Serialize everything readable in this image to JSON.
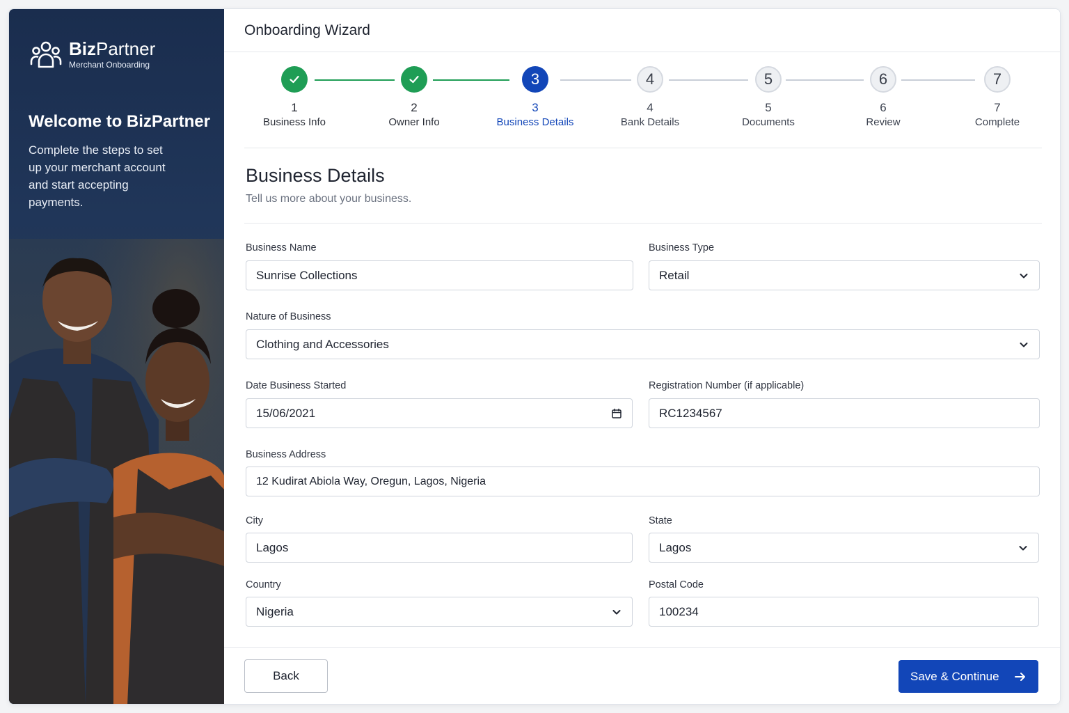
{
  "brand": {
    "name_bold": "Biz",
    "name_rest": "Partner",
    "subtitle": "Merchant Onboarding"
  },
  "sidebar": {
    "welcome_title": "Welcome to BizPartner",
    "welcome_text": "Complete the steps to set up your merchant account and start accepting payments."
  },
  "header": {
    "title": "Onboarding Wizard"
  },
  "steps": [
    {
      "number": "1",
      "label": "Business Info",
      "state": "done"
    },
    {
      "number": "2",
      "label": "Owner Info",
      "state": "done"
    },
    {
      "number": "3",
      "label": "Business Details",
      "state": "active"
    },
    {
      "number": "4",
      "label": "Bank Details",
      "state": "todo"
    },
    {
      "number": "5",
      "label": "Documents",
      "state": "todo"
    },
    {
      "number": "6",
      "label": "Review",
      "state": "todo"
    },
    {
      "number": "7",
      "label": "Complete",
      "state": "todo"
    }
  ],
  "section": {
    "title": "Business Details",
    "subtitle": "Tell us more about your business."
  },
  "form": {
    "business_name": {
      "label": "Business Name",
      "value": "Sunrise Collections"
    },
    "business_type": {
      "label": "Business Type",
      "value": "Retail"
    },
    "nature": {
      "label": "Nature of Business",
      "value": "Clothing and Accessories"
    },
    "date_started": {
      "label": "Date Business Started",
      "value": "15/06/2021"
    },
    "registration": {
      "label": "Registration Number (if applicable)",
      "value": "RC1234567"
    },
    "address": {
      "label": "Business Address",
      "value": "12 Kudirat Abiola Way, Oregun, Lagos, Nigeria"
    },
    "city": {
      "label": "City",
      "value": "Lagos"
    },
    "state": {
      "label": "State",
      "value": "Lagos"
    },
    "country": {
      "label": "Country",
      "value": "Nigeria"
    },
    "postal": {
      "label": "Postal Code",
      "value": "100234"
    }
  },
  "footer": {
    "back_label": "Back",
    "save_label": "Save & Continue"
  },
  "colors": {
    "primary": "#1246b8",
    "success": "#1f9d55",
    "sidebar_bg": "#1a2d4e"
  },
  "icons": {
    "check": "check-icon",
    "chevron": "chevron-down-icon",
    "calendar": "calendar-icon",
    "arrow": "arrow-right-icon",
    "brand": "people-icon"
  }
}
